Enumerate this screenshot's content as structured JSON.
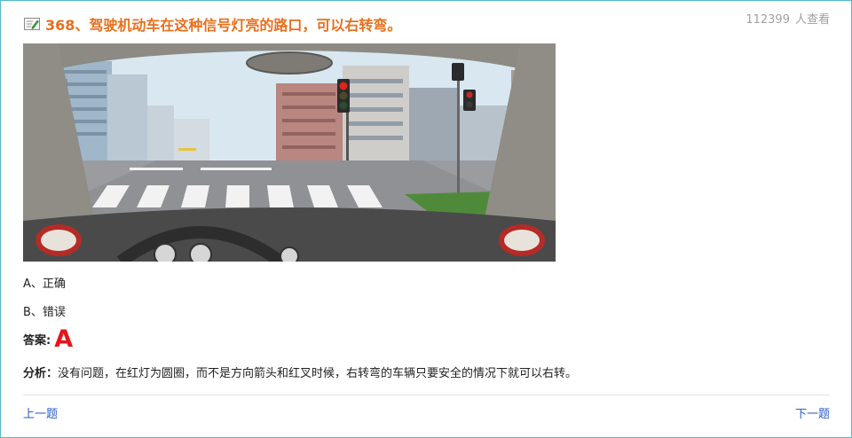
{
  "question": {
    "title": "368、驾驶机动车在这种信号灯亮的路口，可以右转弯。",
    "view_count": "112399",
    "view_suffix": "人查看"
  },
  "options": [
    {
      "label": "A、正确"
    },
    {
      "label": "B、错误"
    }
  ],
  "answer": {
    "label": "答案:",
    "value": "A"
  },
  "analysis": {
    "label": "分析：",
    "text": "没有问题，在红灯为圆圈，而不是方向箭头和红叉时候，右转弯的车辆只要安全的情况下就可以右转。"
  },
  "nav": {
    "prev": "上一题",
    "next": "下一题"
  },
  "colors": {
    "title": "#e86f1c",
    "answer": "#e8141b",
    "link": "#2a5fc4",
    "border": "#52b9c8"
  },
  "icons": {
    "title_icon": "edit-note-icon"
  }
}
